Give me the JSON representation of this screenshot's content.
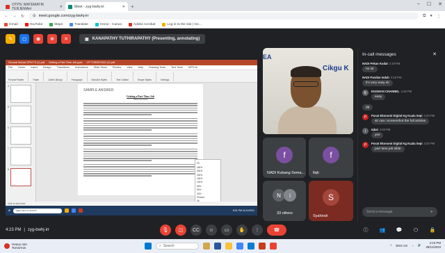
{
  "browser": {
    "tabs": [
      {
        "label": "OTPS: MATEMATIK TERJEMAH",
        "active": false
      },
      {
        "label": "Meet - zyg-bwhj-irr",
        "active": true
      }
    ],
    "new_tab": "+",
    "url": "meet.google.com/zyg-bwhj-irr",
    "bookmarks": [
      "Gmail",
      "YouTube",
      "Maps",
      "Translate",
      "Home - Canva",
      "Adobe Acrobat",
      "Log in to the site | Ge..."
    ]
  },
  "presenter": {
    "banner": "KANAPATHY TUTHIRAPATHY (Presenting, annotating)"
  },
  "presentation": {
    "app_tabs": [
      "Senarai Mutasi SPM T3 (1).pdf",
      "Getting a Part-Time Job.pptx",
      "CP THREE/2021 (1).pdf"
    ],
    "menu": [
      "File",
      "Home",
      "Insert",
      "Design",
      "Transitions",
      "Animations",
      "Slide Show",
      "Review",
      "View",
      "Help",
      "Drawing Tools",
      "Text Tools",
      "WPS AI"
    ],
    "ribbon_groups": [
      "Format Painter",
      "Paste",
      "Calibri (Body)",
      "Paragraph",
      "WordArt Styles",
      "Text Outline",
      "Shape Styles",
      "Settings"
    ],
    "slide_header": "SAMPLE ANSWER",
    "slide_title": "Getting a Part-Time Job",
    "slide_author": "Ahmad Nurfatini",
    "thumb_numbers": [
      "4",
      "5",
      "6",
      "7",
      "8"
    ],
    "zoom_options": [
      "Fit",
      "400%",
      "300%",
      "200%",
      "150%",
      "100%",
      "66%",
      "50%",
      "33%"
    ],
    "zoom_label": "Percent",
    "zoom_value": "45",
    "status_text": "Slide 8 / 9    Office Theme",
    "notes_hint": "Click to add notes",
    "taskbar_search": "Type here to search",
    "clock": "8:51 PM 11/11/2021"
  },
  "tiles": {
    "speaker_sign": "Cikgu K",
    "speaker_logo": "EA",
    "f_tile": {
      "initial": "f",
      "name": "NADI Kubang Sema..."
    },
    "f2_tile": {
      "initial": "f",
      "name": "fiqh"
    },
    "others": {
      "initials": [
        "N",
        "i"
      ],
      "label": "33 others"
    },
    "s_tile": {
      "initial": "S",
      "name": "Syahirah"
    }
  },
  "chat": {
    "title": "In-call messages",
    "input_placeholder": "Send a message",
    "messages": [
      {
        "sender": "NADI Pekan Kudat",
        "time": "4:19 PM",
        "text": "no sir"
      },
      {
        "sender": "NADI Pandan Indah",
        "time": "4:19 PM",
        "text": "it's very easy sir"
      },
      {
        "sender": "EGGMAN CHANNEL",
        "time": "4:19 PM",
        "text": "easy",
        "avatar": "E",
        "avatar_color": "#5f6368"
      },
      {
        "sender": "",
        "time": "",
        "text": "gg"
      },
      {
        "sender": "Pusat Ekonomi Digital Kg Kuala Sepi",
        "time": "4:20 PM",
        "text": "sir can i screenshot the full articles",
        "avatar": "P",
        "avatar_color": "#c5221f"
      },
      {
        "sender": "Iqbal",
        "time": "4:20 PM",
        "text": "yes",
        "avatar": "i",
        "avatar_color": "#5f6368"
      },
      {
        "sender": "Pusat Ekonomi Digital Kg Kuala Sepi",
        "time": "4:20 PM",
        "text": "part time job slide",
        "avatar": "P",
        "avatar_color": "#c5221f"
      }
    ]
  },
  "meeting": {
    "time": "4:23 PM",
    "separator": "|",
    "code": "zyg-bwhj-irr",
    "hand_count": "2"
  },
  "taskbar": {
    "weather_temp": "Heavy rain",
    "weather_sub": "Tomorrow",
    "search": "Search",
    "lang": "ENG US",
    "time": "4:23 PM",
    "date": "28/11/2023"
  },
  "colors": {
    "meet_bg": "#202124",
    "tile_bg": "#3c4043",
    "end_call": "#ea4335"
  }
}
